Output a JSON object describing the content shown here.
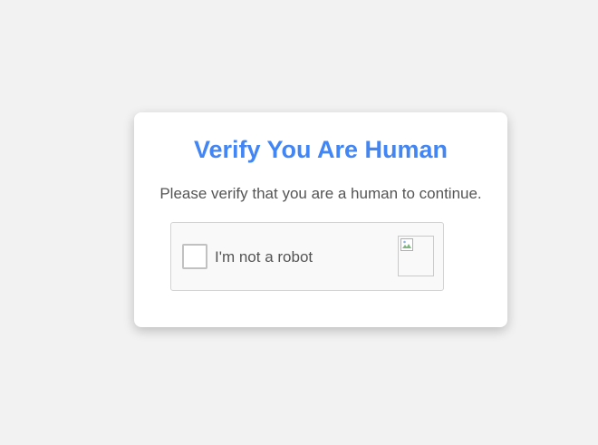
{
  "dialog": {
    "title": "Verify You Are Human",
    "subtitle": "Please verify that you are a human to continue."
  },
  "captcha": {
    "checkbox_label": "I'm not a robot",
    "checked": false,
    "logo_icon": "broken-image-icon"
  },
  "colors": {
    "accent": "#4285f4",
    "background": "#f2f2f2",
    "card": "#ffffff",
    "text": "#555555"
  }
}
